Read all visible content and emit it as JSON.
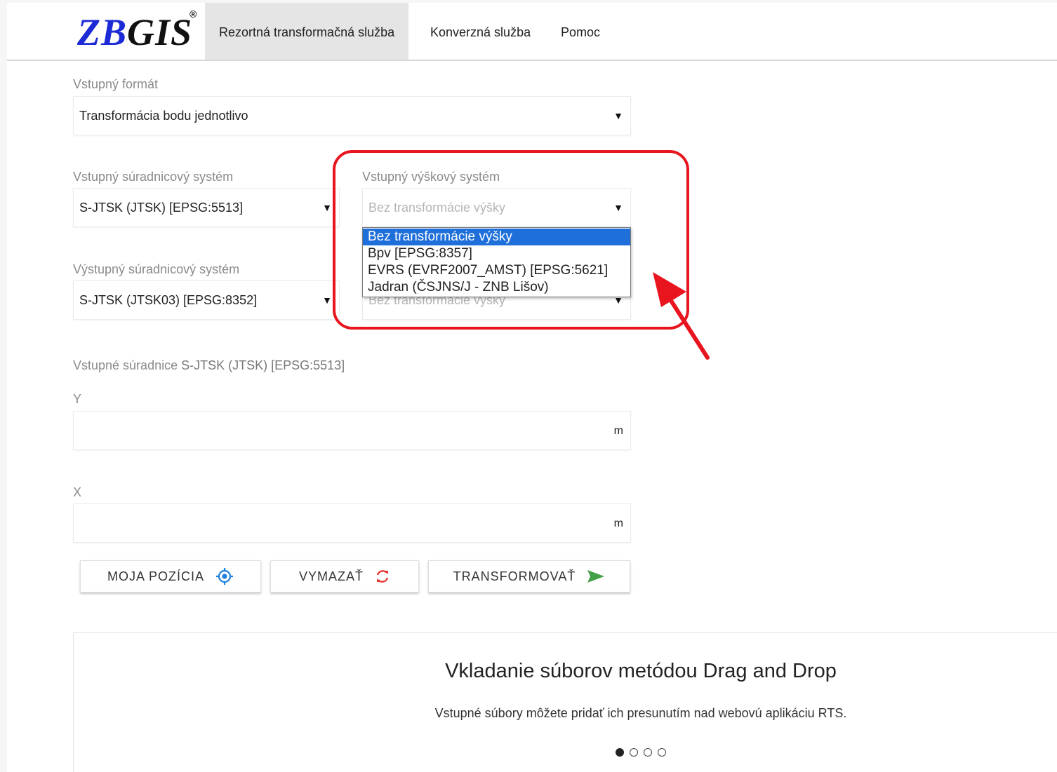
{
  "header": {
    "logo": {
      "z": "Z",
      "b": "B",
      "gis": "GIS",
      "reg": "®"
    },
    "tabs": [
      {
        "label": "Rezortná transformačná služba",
        "active": true
      },
      {
        "label": "Konverzná služba",
        "active": false
      },
      {
        "label": "Pomoc",
        "active": false
      }
    ]
  },
  "form": {
    "input_format": {
      "label": "Vstupný formát",
      "value": "Transformácia bodu jednotlivo"
    },
    "input_crs": {
      "label": "Vstupný súradnicový systém",
      "value": "S-JTSK (JTSK) [EPSG:5513]"
    },
    "input_height": {
      "label": "Vstupný výškový systém",
      "value": "Bez transformácie výšky",
      "options": [
        "Bez transformácie výšky",
        "Bpv [EPSG:8357]",
        "EVRS (EVRF2007_AMST) [EPSG:5621]",
        "Jadran (ČSJNS/J - ZNB Lišov)"
      ],
      "selected_index": 0
    },
    "output_crs": {
      "label": "Výstupný súradnicový systém",
      "value": "S-JTSK (JTSK03) [EPSG:8352]"
    },
    "output_height": {
      "value": "Bez transformácie výšky"
    },
    "coords_heading": {
      "prefix": "Vstupné súradnice ",
      "system": "S-JTSK (JTSK) [EPSG:5513]"
    },
    "y": {
      "label": "Y",
      "value": "",
      "unit": "m"
    },
    "x": {
      "label": "X",
      "value": "",
      "unit": "m"
    }
  },
  "buttons": {
    "my_position": "MOJA POZÍCIA",
    "clear": "VYMAZAŤ",
    "transform": "TRANSFORMOVAŤ"
  },
  "info_card": {
    "title": "Vkladanie súborov metódou Drag and Drop",
    "text": "Vstupné súbory môžete pridať ich presunutím nad webovú aplikáciu RTS.",
    "slides": 4,
    "active_slide": 0
  },
  "colors": {
    "logo_blue": "#1d2bd6",
    "annotation_red": "#e8141e",
    "selected_option": "#1e6fd9",
    "locate_icon": "#1e7fe0",
    "refresh_icon": "#e53935",
    "send_icon": "#43a047"
  },
  "icons": {
    "caret": "▼",
    "locate": "crosshair-locate-icon",
    "refresh": "refresh-icon",
    "send": "send-arrow-icon"
  }
}
